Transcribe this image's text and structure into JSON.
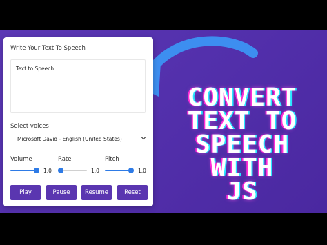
{
  "form": {
    "textarea_label": "Write Your Text To Speech",
    "text_value": "Text to Speech",
    "voices_label": "Select voices",
    "selected_voice": "Microsoft David - English (United States)",
    "sliders": [
      {
        "label": "Volume",
        "value": "1.0",
        "level": 1.0
      },
      {
        "label": "Rate",
        "value": "1.0",
        "level": 0.1
      },
      {
        "label": "Pitch",
        "value": "1.0",
        "level": 1.0
      }
    ],
    "buttons": [
      "Play",
      "Pause",
      "Resume",
      "Reset"
    ]
  },
  "headline": [
    "CONVERT",
    "TEXT TO",
    "SPEECH",
    "WITH",
    "JS"
  ],
  "colors": {
    "accent": "#5a36b0",
    "slider": "#2e7be6",
    "background": "#5330ac",
    "arrow": "#3d8ef0"
  }
}
